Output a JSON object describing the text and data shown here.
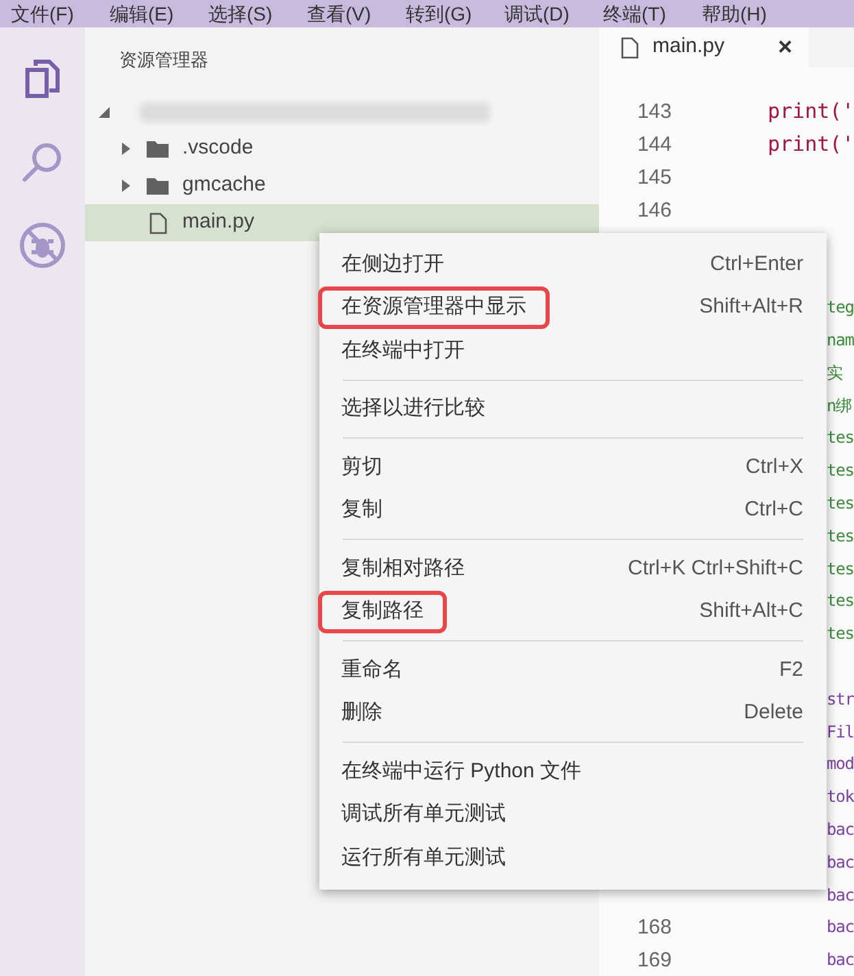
{
  "menu_bar": [
    "文件(F)",
    "编辑(E)",
    "选择(S)",
    "查看(V)",
    "转到(G)",
    "调试(D)",
    "终端(T)",
    "帮助(H)"
  ],
  "activity_bar": [
    {
      "kind": "files",
      "selected": true
    },
    {
      "kind": "search",
      "selected": false
    },
    {
      "kind": "debug",
      "selected": false
    }
  ],
  "explorer": {
    "title": "资源管理器",
    "items": [
      {
        "kind": "folder",
        "name": ".vscode",
        "selected": false
      },
      {
        "kind": "folder",
        "name": "gmcache",
        "selected": false
      },
      {
        "kind": "file",
        "name": "main.py",
        "selected": true
      }
    ]
  },
  "tab": {
    "title": "main.py",
    "close": "×"
  },
  "editor_lines": [
    {
      "number": "143",
      "code": "print('",
      "color": "#a31549",
      "kind": "block"
    },
    {
      "number": "144",
      "code": "print('",
      "color": "#a31549",
      "kind": "block"
    },
    {
      "number": "145",
      "kind": "blank"
    },
    {
      "number": "146",
      "kind": "blank"
    },
    {
      "kind": "blank"
    },
    {
      "kind": "blank"
    },
    {
      "code": "teg",
      "color": "#3d8a3d",
      "kind": "clipped"
    },
    {
      "code": "nam",
      "color": "#3d8a3d",
      "kind": "clipped"
    },
    {
      "code": "实",
      "color": "#3d8a3d",
      "kind": "clipped"
    },
    {
      "code": "n绑",
      "color": "#3d8a3d",
      "kind": "clipped"
    },
    {
      "code": "tes",
      "color": "#3d8a3d",
      "kind": "clipped"
    },
    {
      "code": "tes",
      "color": "#3d8a3d",
      "kind": "clipped"
    },
    {
      "code": "tes",
      "color": "#3d8a3d",
      "kind": "clipped"
    },
    {
      "code": "tes",
      "color": "#3d8a3d",
      "kind": "clipped"
    },
    {
      "code": "tes",
      "color": "#3d8a3d",
      "kind": "clipped"
    },
    {
      "code": "tes",
      "color": "#3d8a3d",
      "kind": "clipped"
    },
    {
      "code": "tes",
      "color": "#3d8a3d",
      "kind": "clipped"
    },
    {
      "kind": "blank"
    },
    {
      "code": "str",
      "color": "#7b3fa0",
      "kind": "clipped"
    },
    {
      "code": "Fil",
      "color": "#7b3fa0",
      "kind": "clipped"
    },
    {
      "code": "mod",
      "color": "#7b3fa0",
      "kind": "clipped"
    },
    {
      "code": "tok",
      "color": "#7b3fa0",
      "kind": "clipped"
    },
    {
      "code": "bac",
      "color": "#7b3fa0",
      "kind": "clipped"
    },
    {
      "code": "bac",
      "color": "#7b3fa0",
      "kind": "clipped"
    },
    {
      "code": "bac",
      "color": "#7b3fa0",
      "kind": "clipped"
    },
    {
      "number": "168",
      "code": "bac",
      "color": "#7b3fa0",
      "kind": "clipped"
    },
    {
      "number": "169",
      "code": "bac",
      "color": "#7b3fa0",
      "kind": "clipped"
    }
  ],
  "context_menu": [
    [
      {
        "label": "在侧边打开",
        "shortcut": "Ctrl+Enter",
        "highlighted": false
      },
      {
        "label": "在资源管理器中显示",
        "shortcut": "Shift+Alt+R",
        "highlighted": true
      },
      {
        "label": "在终端中打开",
        "highlighted": false
      }
    ],
    [
      {
        "label": "选择以进行比较",
        "highlighted": false
      }
    ],
    [
      {
        "label": "剪切",
        "shortcut": "Ctrl+X",
        "highlighted": false
      },
      {
        "label": "复制",
        "shortcut": "Ctrl+C",
        "highlighted": false
      }
    ],
    [
      {
        "label": "复制相对路径",
        "shortcut": "Ctrl+K Ctrl+Shift+C",
        "highlighted": false
      },
      {
        "label": "复制路径",
        "shortcut": "Shift+Alt+C",
        "highlighted": true
      }
    ],
    [
      {
        "label": "重命名",
        "shortcut": "F2",
        "highlighted": false
      },
      {
        "label": "删除",
        "shortcut": "Delete",
        "highlighted": false
      }
    ],
    [
      {
        "label": "在终端中运行 Python 文件",
        "highlighted": false
      },
      {
        "label": "调试所有单元测试",
        "highlighted": false
      },
      {
        "label": "运行所有单元测试",
        "highlighted": false
      }
    ]
  ]
}
